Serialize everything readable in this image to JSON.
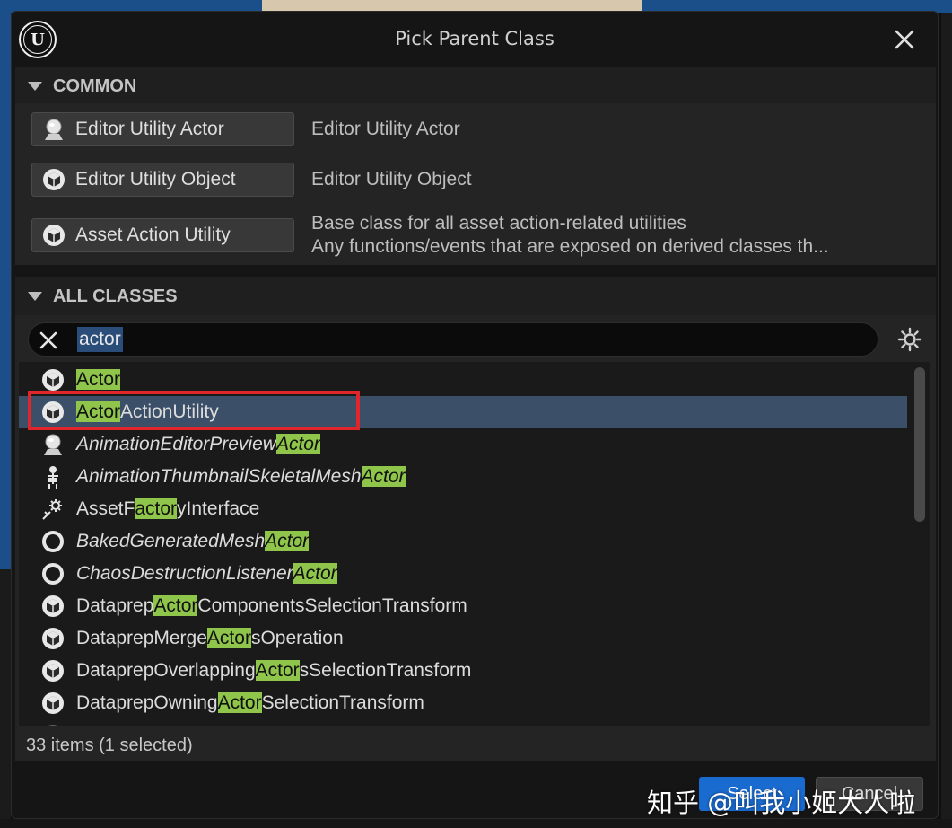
{
  "window": {
    "title": "Pick Parent Class"
  },
  "common": {
    "header": "COMMON",
    "items": [
      {
        "label": "Editor Utility Actor",
        "icon": "actor-sphere-icon",
        "description": [
          "Editor Utility Actor"
        ]
      },
      {
        "label": "Editor Utility Object",
        "icon": "object-cube-icon",
        "description": [
          "Editor Utility Object"
        ]
      },
      {
        "label": "Asset Action Utility",
        "icon": "object-cube-icon",
        "description": [
          "Base class for all asset action-related utilities",
          "Any functions/events that are exposed on derived classes th..."
        ]
      }
    ]
  },
  "all_classes": {
    "header": "ALL CLASSES",
    "search": {
      "value": "actor"
    },
    "items": [
      {
        "pre": "",
        "match": "Actor",
        "post": "",
        "icon": "object-cube-icon",
        "italic": false,
        "selected": false
      },
      {
        "pre": "",
        "match": "Actor",
        "post": "ActionUtility",
        "icon": "object-cube-icon",
        "italic": false,
        "selected": true
      },
      {
        "pre": "AnimationEditorPreview",
        "match": "Actor",
        "post": "",
        "icon": "actor-sphere-icon",
        "italic": true,
        "selected": false
      },
      {
        "pre": "AnimationThumbnailSkeletalMesh",
        "match": "Actor",
        "post": "",
        "icon": "skeleton-icon",
        "italic": true,
        "selected": false
      },
      {
        "pre": "AssetF",
        "match": "actor",
        "post": "yInterface",
        "icon": "factory-gear-icon",
        "italic": false,
        "selected": false
      },
      {
        "pre": "BakedGeneratedMesh",
        "match": "Actor",
        "post": "",
        "icon": "ring-icon",
        "italic": true,
        "selected": false
      },
      {
        "pre": "ChaosDestructionListener",
        "match": "Actor",
        "post": "",
        "icon": "ring-icon",
        "italic": true,
        "selected": false
      },
      {
        "pre": "Dataprep",
        "match": "Actor",
        "post": "ComponentsSelectionTransform",
        "icon": "object-cube-icon",
        "italic": false,
        "selected": false
      },
      {
        "pre": "DataprepMerge",
        "match": "Actor",
        "post": "sOperation",
        "icon": "object-cube-icon",
        "italic": false,
        "selected": false
      },
      {
        "pre": "DataprepOverlapping",
        "match": "Actor",
        "post": "sSelectionTransform",
        "icon": "object-cube-icon",
        "italic": false,
        "selected": false
      },
      {
        "pre": "DataprepOwning",
        "match": "Actor",
        "post": "SelectionTransform",
        "icon": "object-cube-icon",
        "italic": false,
        "selected": false
      }
    ],
    "status": "33 items (1 selected)"
  },
  "footer": {
    "select_label": "Select",
    "cancel_label": "Cancel"
  },
  "watermark": "知乎 @叫我小姬大人啦",
  "colors": {
    "highlight": "#8fc54a",
    "selected_row": "#3b4f68",
    "annotation": "#e0262b",
    "primary": "#1a6bd0"
  }
}
